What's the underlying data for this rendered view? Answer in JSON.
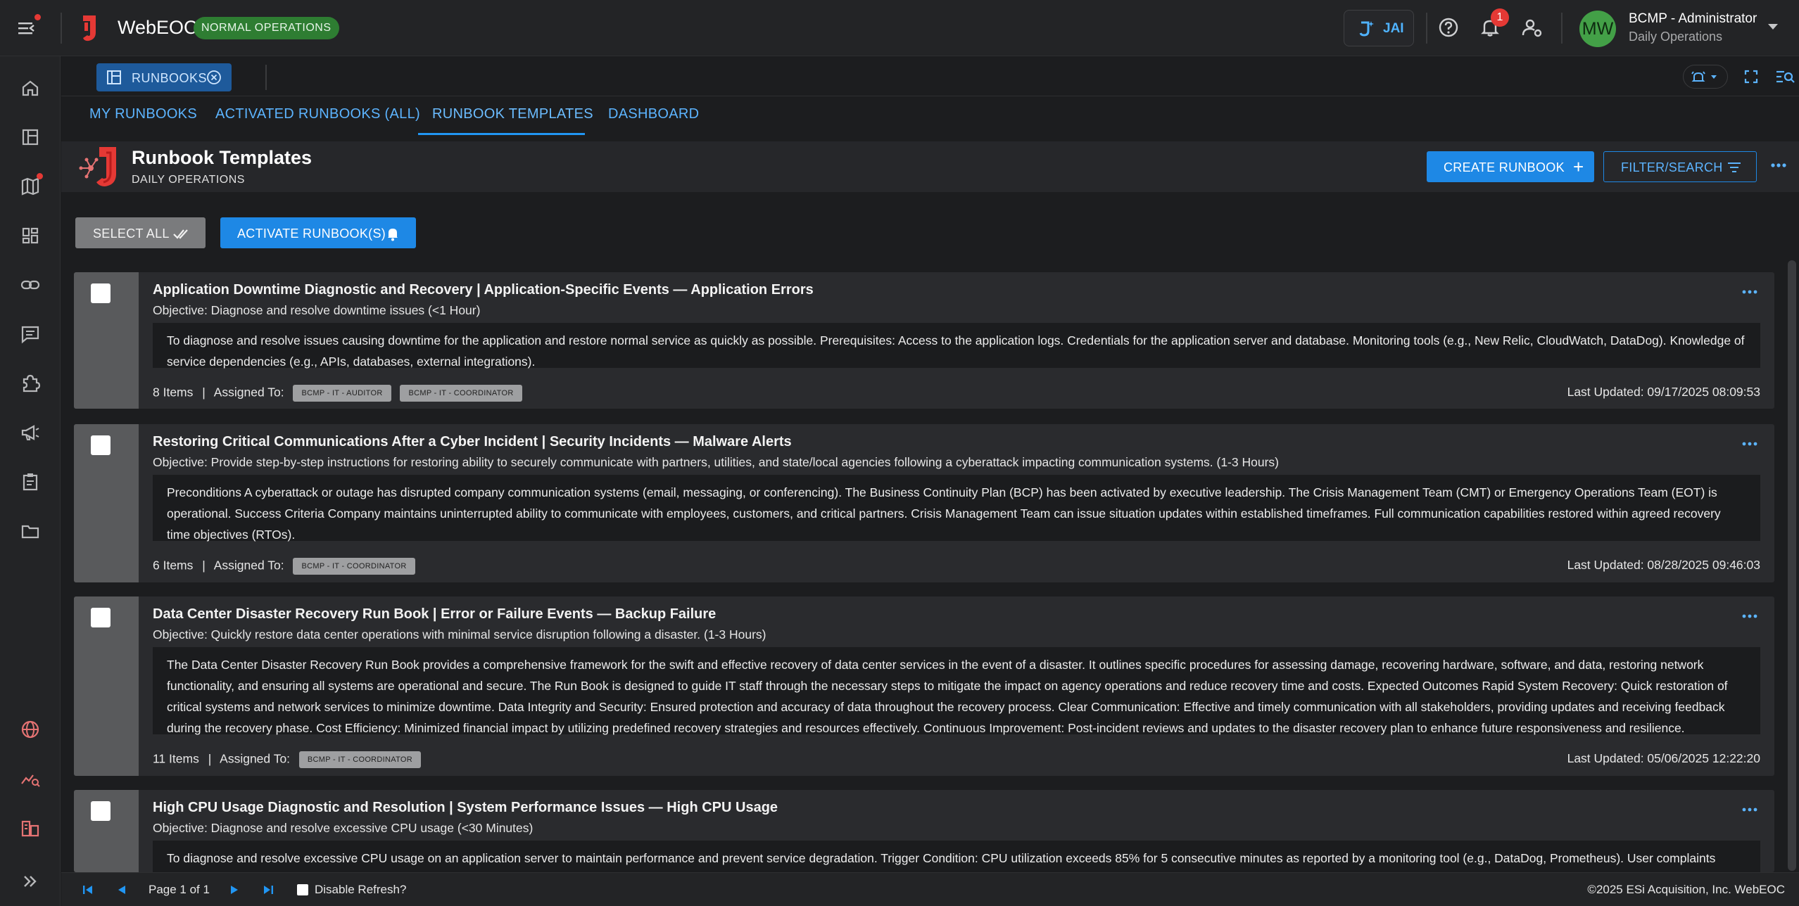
{
  "topbar": {
    "brand": "WebEOC",
    "mode_badge": "NORMAL OPERATIONS",
    "jai_label": "JAI",
    "notification_count": "1",
    "avatar_initials": "MW",
    "user_name": "BCMP - Administrator",
    "user_role": "Daily Operations"
  },
  "tabstrip": {
    "open_tab_label": "RUNBOOKS"
  },
  "nav": {
    "tabs": [
      "MY RUNBOOKS",
      "ACTIVATED RUNBOOKS (ALL)",
      "RUNBOOK TEMPLATES",
      "DASHBOARD"
    ],
    "active_index": 2
  },
  "header": {
    "title": "Runbook Templates",
    "subtitle": "DAILY OPERATIONS",
    "create_label": "CREATE RUNBOOK",
    "filter_label": "FILTER/SEARCH"
  },
  "actions": {
    "select_all_label": "SELECT ALL",
    "activate_label": "ACTIVATE RUNBOOK(S)"
  },
  "cards": [
    {
      "title": "Application Downtime Diagnostic and Recovery | Application-Specific Events  — Application Errors",
      "objective": "Objective: Diagnose and resolve downtime issues   (<1 Hour)",
      "description": "To diagnose and resolve issues causing downtime for the application and restore normal service as quickly as possible. Prerequisites: Access to the application logs. Credentials for the application server and database. Monitoring tools (e.g., New Relic, CloudWatch, DataDog). Knowledge of service dependencies (e.g., APIs, databases, external integrations).",
      "items": "8 Items",
      "assigned_label": "Assigned To:",
      "tags": [
        "BCMP - IT - AUDITOR",
        "BCMP - IT - COORDINATOR"
      ],
      "updated": "Last Updated: 09/17/2025 08:09:53"
    },
    {
      "title": "Restoring Critical Communications After a Cyber Incident | Security Incidents  — Malware Alerts",
      "objective": "Objective: Provide step-by-step instructions for restoring ability to securely communicate with partners, utilities, and state/local agencies following a cyberattack impacting communication systems.   (1-3 Hours)",
      "description": "Preconditions A cyberattack or outage has disrupted company communication systems (email, messaging, or conferencing). The Business Continuity Plan (BCP) has been activated by executive leadership. The Crisis Management Team (CMT) or Emergency Operations Team (EOT) is operational. Success Criteria Company maintains uninterrupted ability to communicate with employees, customers, and critical partners. Crisis Management Team can issue situation updates within established timeframes. Full communication capabilities restored within agreed recovery time objectives (RTOs).",
      "items": "6 Items",
      "assigned_label": "Assigned To:",
      "tags": [
        "BCMP - IT - COORDINATOR"
      ],
      "updated": "Last Updated: 08/28/2025 09:46:03"
    },
    {
      "title": "Data Center Disaster Recovery Run Book | Error or Failure Events  — Backup Failure",
      "objective": "Objective: Quickly restore data center operations with minimal service disruption following a disaster.   (1-3 Hours)",
      "description": "The Data Center Disaster Recovery Run Book provides a comprehensive framework for the swift and effective recovery of data center services in the event of a disaster. It outlines specific procedures for assessing damage, recovering hardware, software, and data, restoring network functionality, and ensuring all systems are operational and secure. The Run Book is designed to guide IT staff through the necessary steps to mitigate the impact on agency operations and reduce recovery time and costs. Expected Outcomes Rapid System Recovery: Quick restoration of critical systems and network services to minimize downtime. Data Integrity and Security: Ensured protection and accuracy of data throughout the recovery process. Clear Communication: Effective and timely communication with all stakeholders, providing updates and receiving feedback during the recovery phase. Cost Efficiency: Minimized financial impact by utilizing predefined recovery strategies and resources effectively. Continuous Improvement: Post-incident reviews and updates to the disaster recovery plan to enhance future responsiveness and resilience.",
      "items": "11 Items",
      "assigned_label": "Assigned To:",
      "tags": [
        "BCMP - IT - COORDINATOR"
      ],
      "updated": "Last Updated: 05/06/2025 12:22:20"
    },
    {
      "title": "High CPU Usage Diagnostic and Resolution | System Performance Issues  — High CPU Usage",
      "objective": "Objective: Diagnose and resolve excessive CPU usage   (<30 Minutes)",
      "description": "To diagnose and resolve excessive CPU usage on an application server to maintain performance and prevent service degradation. Trigger Condition: CPU utilization exceeds 85% for 5 consecutive minutes as reported by a monitoring tool (e.g., DataDog, Prometheus). User complaints"
    }
  ],
  "footer": {
    "page_text": "Page 1 of 1",
    "disable_refresh_label": "Disable Refresh?",
    "copyright": "©2025 ESi Acquisition, Inc. WebEOC"
  },
  "colors": {
    "accent": "#1e88e5",
    "link": "#5cb4ff",
    "status_green": "#2e7d32",
    "alert_red": "#e53935",
    "background": "#1c1d1f"
  }
}
